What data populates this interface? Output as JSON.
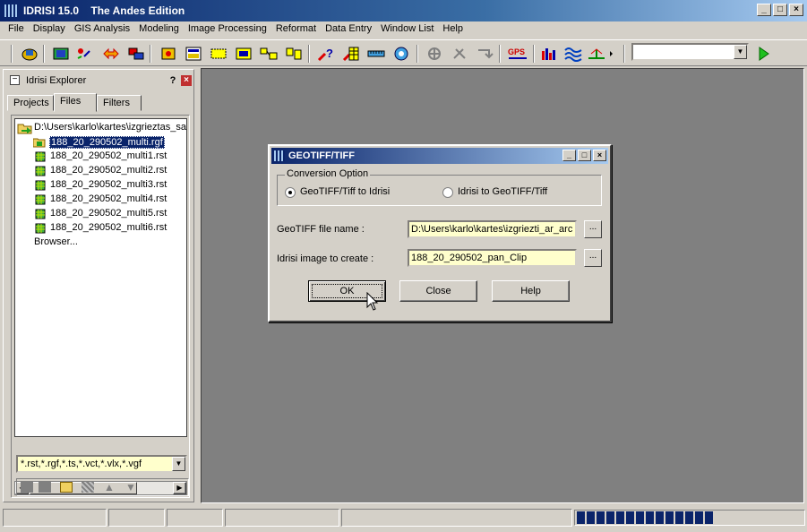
{
  "app": {
    "title": "IDRISI 15.0    The Andes Edition",
    "window_buttons": [
      "_",
      "□",
      "×"
    ]
  },
  "menu": [
    "File",
    "Display",
    "GIS Analysis",
    "Modeling",
    "Image Processing",
    "Reformat",
    "Data Entry",
    "Window List",
    "Help"
  ],
  "toolbar": {
    "gps_label": "GPS",
    "combo_value": "",
    "icons": [
      "display-launcher-icon",
      "composite-icon",
      "symbol-workshop-icon",
      "link-icon",
      "layer-icon",
      "add-layer-icon",
      "map-properties-icon",
      "measure-icon",
      "pan-icon",
      "zoom-icon",
      "feature-properties-icon",
      "query-icon",
      "digitize-icon",
      "ruler-icon",
      "globe-icon",
      "crosshair-icon",
      "edit-icon",
      "undo-icon",
      "gps-icon",
      "histogram-icon",
      "wave-icon",
      "profile-icon",
      "run-icon"
    ]
  },
  "explorer": {
    "title": "Idrisi Explorer",
    "help": "?",
    "close": "×",
    "tabs": [
      "Projects",
      "Files",
      "Filters"
    ],
    "active_tab": "Files",
    "folder": "D:\\Users\\karlo\\kartes\\izgrieztas_sa",
    "files": [
      "188_20_290502_multi.rgf",
      "188_20_290502_multi1.rst",
      "188_20_290502_multi2.rst",
      "188_20_290502_multi3.rst",
      "188_20_290502_multi4.rst",
      "188_20_290502_multi5.rst",
      "188_20_290502_multi6.rst"
    ],
    "browser": "Browser...",
    "filter": "*.rst,*.rgf,*.ts,*.vct,*.vlx,*.vgf"
  },
  "dialog": {
    "title": "GEOTIFF/TIFF",
    "group_label": "Conversion Option",
    "option_a": "GeoTIFF/Tiff to Idrisi",
    "option_b": "Idrisi to GeoTIFF/Tiff",
    "selected_option": "GeoTIFF/Tiff to Idrisi",
    "geotiff_label": "GeoTIFF file name :",
    "geotiff_value": "D:\\Users\\karlo\\kartes\\izgriezti_ar_arc",
    "idrisi_label": "Idrisi image to create :",
    "idrisi_value": "188_20_290502_pan_Clip",
    "browse": "...",
    "ok": "OK",
    "close": "Close",
    "help": "Help"
  },
  "status": {
    "progress_blocks": 14
  },
  "colors": {
    "title_dark": "#0a246a",
    "title_light": "#a6caf0",
    "face": "#d4d0c8",
    "workspace": "#808080",
    "input_bg": "#ffffcc"
  }
}
